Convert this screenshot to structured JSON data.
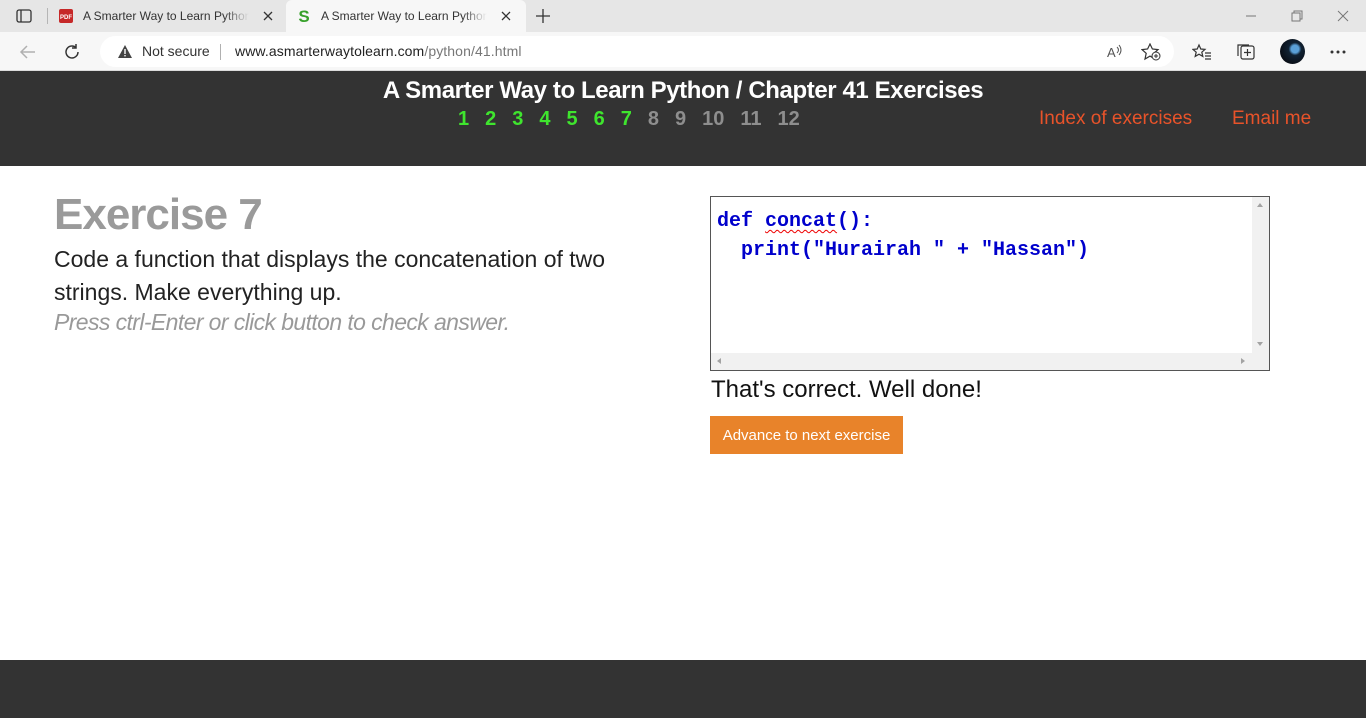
{
  "browser": {
    "tabs": [
      {
        "title": "A Smarter Way to Learn Python - ",
        "icon": "pdf-icon"
      },
      {
        "title": "A Smarter Way to Learn Python - ",
        "icon": "s-logo-icon",
        "active": true
      }
    ],
    "security_label": "Not secure",
    "url_domain": "www.asmarterwaytolearn.com",
    "url_path": "/python/41.html"
  },
  "header": {
    "title": "A Smarter Way to Learn Python / Chapter 41 Exercises",
    "exercise_numbers": [
      {
        "n": "1",
        "done": true
      },
      {
        "n": "2",
        "done": true
      },
      {
        "n": "3",
        "done": true
      },
      {
        "n": "4",
        "done": true
      },
      {
        "n": "5",
        "done": true
      },
      {
        "n": "6",
        "done": true
      },
      {
        "n": "7",
        "done": true
      },
      {
        "n": "8",
        "done": false
      },
      {
        "n": "9",
        "done": false
      },
      {
        "n": "10",
        "done": false
      },
      {
        "n": "11",
        "done": false
      },
      {
        "n": "12",
        "done": false
      }
    ],
    "index_link": "Index of exercises",
    "email_link": "Email me"
  },
  "exercise": {
    "title": "Exercise 7",
    "text": "Code a function that displays the concatenation of two strings. Make everything up.",
    "hint": "Press ctrl-Enter or click button to check answer."
  },
  "editor": {
    "line1_kw": "def",
    "line1_name": "concat",
    "line1_rest": "():",
    "line2": "  print(\"Hurairah \" + \"Hassan\")"
  },
  "result": "That's correct. Well done!",
  "next_button": "Advance to next exercise",
  "colors": {
    "header_bg": "#333333",
    "done_green": "#3fe52e",
    "link_orange": "#e8532a",
    "button_orange": "#e8832a",
    "code_blue": "#0000cc"
  }
}
